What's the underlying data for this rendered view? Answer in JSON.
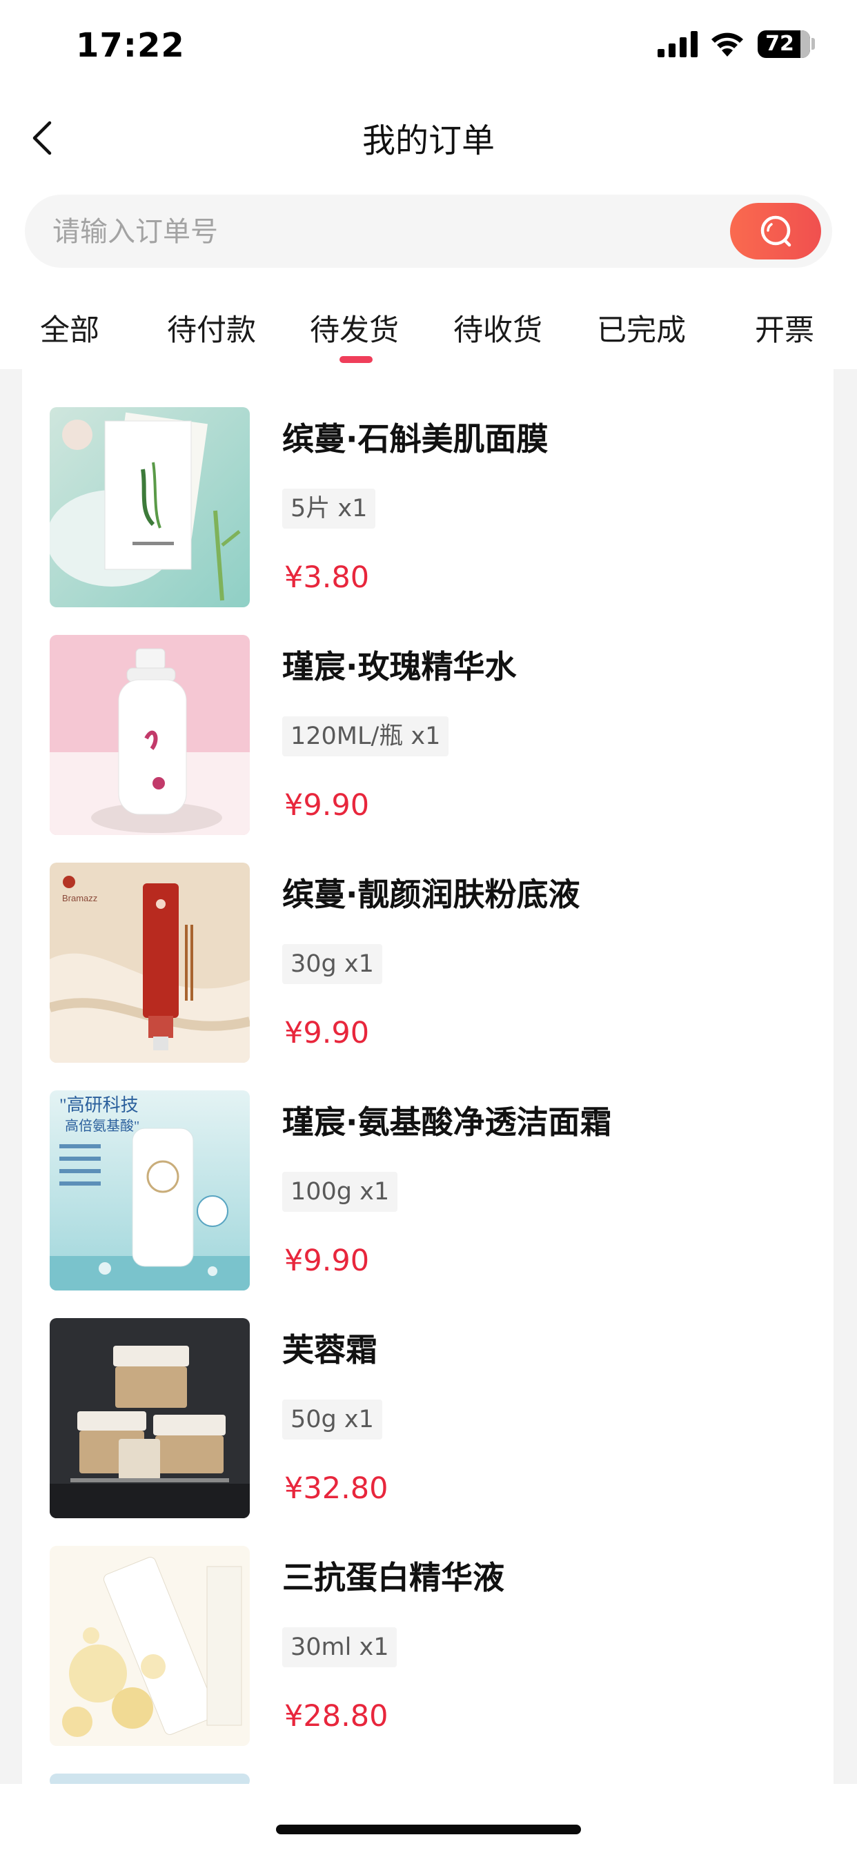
{
  "status_bar": {
    "time": "17:22",
    "battery": "72"
  },
  "header": {
    "title": "我的订单",
    "back_icon": "chevron-left-icon"
  },
  "search": {
    "placeholder": "请输入订单号",
    "value": "",
    "button_icon": "search-icon",
    "button_color": "#f65a4f"
  },
  "tabs": [
    {
      "label": "全部",
      "active": false
    },
    {
      "label": "待付款",
      "active": false
    },
    {
      "label": "待发货",
      "active": true
    },
    {
      "label": "待收货",
      "active": false
    },
    {
      "label": "已完成",
      "active": false
    },
    {
      "label": "开票",
      "active": false
    }
  ],
  "colors": {
    "accent": "#ef3e5a",
    "price": "#e8263c"
  },
  "products": [
    {
      "name": "缤蔓·石斛美肌面膜",
      "spec": "5片 x1",
      "price": "¥3.80",
      "image": "face-mask-product-image"
    },
    {
      "name": "瑾宸·玫瑰精华水",
      "spec": "120ML/瓶 x1",
      "price": "¥9.90",
      "image": "rose-toner-bottle-image"
    },
    {
      "name": "缤蔓·靓颜润肤粉底液",
      "spec": "30g x1",
      "price": "¥9.90",
      "image": "foundation-tube-image",
      "image_text": "Bramazz"
    },
    {
      "name": "瑾宸·氨基酸净透洁面霜",
      "spec": "100g x1",
      "price": "¥9.90",
      "image": "cleanser-tube-image",
      "image_text": "高研科技 高倍氨基酸"
    },
    {
      "name": "芙蓉霜",
      "spec": "50g x1",
      "price": "¥32.80",
      "image": "cream-jars-image"
    },
    {
      "name": "三抗蛋白精华液",
      "spec": "30ml x1",
      "price": "¥28.80",
      "image": "serum-bottle-image"
    }
  ]
}
